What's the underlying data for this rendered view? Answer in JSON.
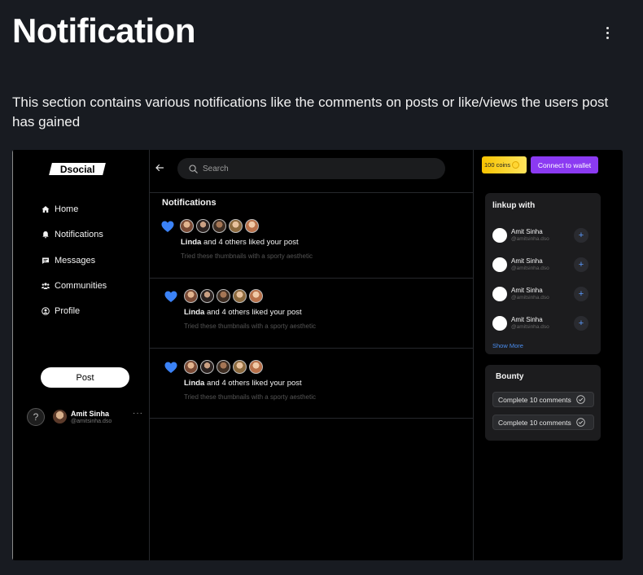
{
  "header": {
    "title": "Notification",
    "description": "This section contains various notifications like the comments on posts or like/views the users post has gained"
  },
  "app": {
    "logo": "Dsocial",
    "sidebar": {
      "items": [
        {
          "label": "Home",
          "icon": "home-icon"
        },
        {
          "label": "Notifications",
          "icon": "bell-icon"
        },
        {
          "label": "Messages",
          "icon": "message-icon"
        },
        {
          "label": "Communities",
          "icon": "communities-icon"
        },
        {
          "label": "Profile",
          "icon": "profile-icon"
        }
      ],
      "post_label": "Post",
      "help_label": "?",
      "user": {
        "name": "Amit Sinha",
        "handle": "@amitsinha.dso",
        "more": "···"
      }
    },
    "search": {
      "placeholder": "Search"
    },
    "notifications": {
      "heading": "Notifications",
      "items": [
        {
          "actor": "Linda",
          "text": " and 4 others liked your post",
          "sub": "Tried these thumbnails with a sporty aesthetic"
        },
        {
          "actor": "Linda",
          "text": " and 4 others liked your post",
          "sub": "Tried these thumbnails with a sporty aesthetic"
        },
        {
          "actor": "Linda",
          "text": " and 4 others liked your post",
          "sub": "Tried these thumbnails with a sporty aesthetic"
        }
      ]
    },
    "coins_label": "100 coins",
    "wallet_label": "Connect to wallet",
    "linkup": {
      "title": "linkup with",
      "people": [
        {
          "name": "Amit Sinha",
          "handle": "@amitsinha.dso"
        },
        {
          "name": "Amit Sinha",
          "handle": "@amitsinha.dso"
        },
        {
          "name": "Amit Sinha",
          "handle": "@amitsinha.dso"
        },
        {
          "name": "Amit Sinha",
          "handle": "@amitsinha.dso"
        }
      ],
      "add_label": "+",
      "show_more": "Show More"
    },
    "bounty": {
      "title": "Bounty",
      "items": [
        "Complete 10 comments",
        "Complete 10 comments"
      ]
    }
  },
  "colors": {
    "background": "#181b21",
    "heart": "#3b82f6",
    "wallet": "#8b3af2",
    "coins": "#f7c300",
    "link": "#4a8df0"
  }
}
